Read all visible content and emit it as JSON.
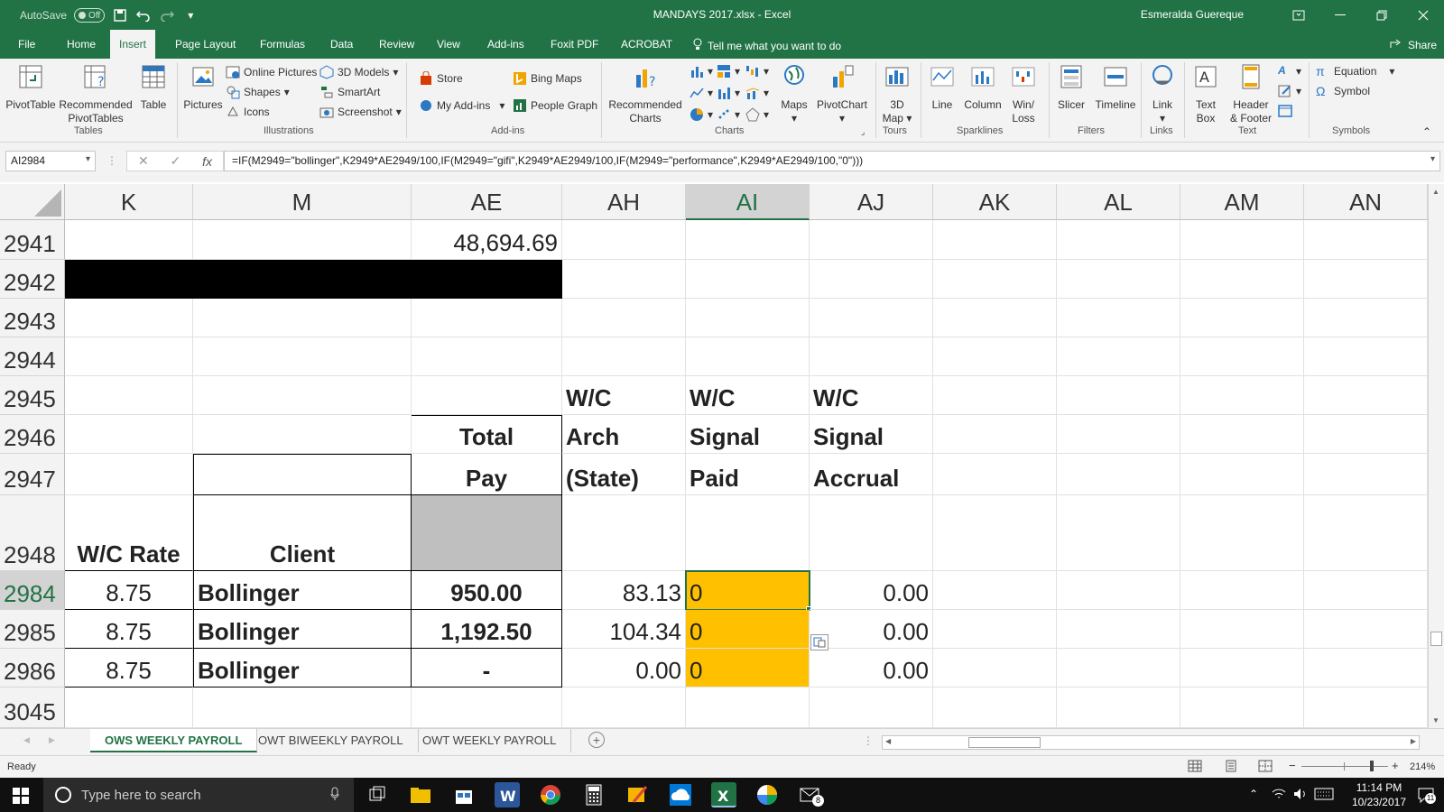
{
  "titlebar": {
    "autosave_label": "AutoSave",
    "autosave_state": "Off",
    "title": "MANDAYS 2017.xlsx  -  Excel",
    "user": "Esmeralda Guereque"
  },
  "tabs": [
    "File",
    "Home",
    "Insert",
    "Page Layout",
    "Formulas",
    "Data",
    "Review",
    "View",
    "Add-ins",
    "Foxit PDF",
    "ACROBAT"
  ],
  "active_tab": "Insert",
  "tellme": "Tell me what you want to do",
  "share": "Share",
  "ribbon": {
    "tables": {
      "pivot": "PivotTable",
      "recommended1": "Recommended",
      "recommended2": "PivotTables",
      "table": "Table",
      "group": "Tables"
    },
    "illustrations": {
      "pictures": "Pictures",
      "online": "Online Pictures",
      "shapes": "Shapes",
      "icons": "Icons",
      "models": "3D Models",
      "smartart": "SmartArt",
      "screenshot": "Screenshot",
      "group": "Illustrations"
    },
    "addins": {
      "store": "Store",
      "myaddins": "My Add-ins",
      "bing": "Bing Maps",
      "people": "People Graph",
      "group": "Add-ins"
    },
    "charts": {
      "recommended1": "Recommended",
      "recommended2": "Charts",
      "maps": "Maps",
      "pivotchart": "PivotChart",
      "group": "Charts"
    },
    "tours": {
      "map1": "3D",
      "map2": "Map",
      "group": "Tours"
    },
    "sparklines": {
      "line": "Line",
      "column": "Column",
      "winloss1": "Win/",
      "winloss2": "Loss",
      "group": "Sparklines"
    },
    "filters": {
      "slicer": "Slicer",
      "timeline": "Timeline",
      "group": "Filters"
    },
    "links": {
      "link": "Link",
      "group": "Links"
    },
    "text": {
      "textbox1": "Text",
      "textbox2": "Box",
      "header1": "Header",
      "header2": "& Footer",
      "group": "Text"
    },
    "symbols": {
      "equation": "Equation",
      "symbol": "Symbol",
      "group": "Symbols"
    }
  },
  "formula_bar": {
    "name_box": "AI2984",
    "formula": "=IF(M2949=\"bollinger\",K2949*AE2949/100,IF(M2949=\"gifi\",K2949*AE2949/100,IF(M2949=\"performance\",K2949*AE2949/100,\"0\")))"
  },
  "columns": [
    "K",
    "M",
    "AE",
    "AH",
    "AI",
    "AJ",
    "AK",
    "AL",
    "AM",
    "AN"
  ],
  "selected_column": "AI",
  "rows": [
    {
      "num": "2941",
      "cells": {
        "AE": "48,694.69"
      }
    },
    {
      "num": "2942",
      "cells": {}
    },
    {
      "num": "2943",
      "cells": {}
    },
    {
      "num": "2944",
      "cells": {}
    },
    {
      "num": "2945",
      "cells": {
        "AH": "W/C",
        "AI": "W/C",
        "AJ": "W/C"
      }
    },
    {
      "num": "2946",
      "cells": {
        "AE": "Total",
        "AH": "Arch",
        "AI": "Signal",
        "AJ": "Signal"
      }
    },
    {
      "num": "2947",
      "cells": {
        "AE": "Pay",
        "AH": "(State)",
        "AI": "Paid",
        "AJ": "Accrual"
      }
    },
    {
      "num": "2948",
      "cells": {
        "K": "W/C Rate",
        "M": "Client"
      }
    },
    {
      "num": "2984",
      "cells": {
        "K": "8.75",
        "M": "Bollinger",
        "AE": "950.00",
        "AH": "83.13",
        "AI": "0",
        "AJ": "0.00"
      }
    },
    {
      "num": "2985",
      "cells": {
        "K": "8.75",
        "M": "Bollinger",
        "AE": "1,192.50",
        "AH": "104.34",
        "AI": "0",
        "AJ": "0.00"
      }
    },
    {
      "num": "2986",
      "cells": {
        "K": "8.75",
        "M": "Bollinger",
        "AE": "-",
        "AH": "0.00",
        "AI": "0",
        "AJ": "0.00"
      }
    },
    {
      "num": "3045",
      "cells": {}
    }
  ],
  "selected_row": "2984",
  "colors": {
    "excel_green": "#217346",
    "highlight": "#ffc000",
    "header_gray": "#bfbfbf",
    "black_bar": "#000000"
  },
  "sheets": [
    "OWS WEEKLY PAYROLL",
    "OWT BIWEEKLY PAYROLL",
    "OWT WEEKLY PAYROLL"
  ],
  "active_sheet": "OWS WEEKLY PAYROLL",
  "status": {
    "ready": "Ready",
    "zoom": "214%"
  },
  "taskbar": {
    "search_placeholder": "Type here to search",
    "time": "11:14 PM",
    "date": "10/23/2017",
    "mail_badge": "8",
    "notif_badge": "11"
  }
}
